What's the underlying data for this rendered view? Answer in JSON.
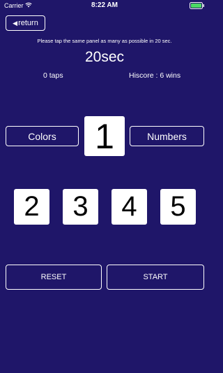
{
  "status_bar": {
    "carrier": "Carrier",
    "time": "8:22 AM",
    "wifi_icon": "wifi-icon",
    "battery_icon": "battery-icon",
    "battery_color": "#4cd964"
  },
  "header": {
    "return_label": "return",
    "return_icon": "left-triangle-icon"
  },
  "instructions": "Please tap the same panel as many as possible in 20 sec.",
  "timer": "20sec",
  "stats": {
    "taps": "0 taps",
    "hiscore": "Hiscore : 6 wins"
  },
  "modes": {
    "colors_label": "Colors",
    "numbers_label": "Numbers"
  },
  "target_panel": "1",
  "choice_panels": [
    "2",
    "3",
    "4",
    "5"
  ],
  "actions": {
    "reset_label": "RESET",
    "start_label": "START"
  },
  "colors": {
    "background": "#1f1669",
    "panel": "#ffffff",
    "text": "#ffffff"
  }
}
